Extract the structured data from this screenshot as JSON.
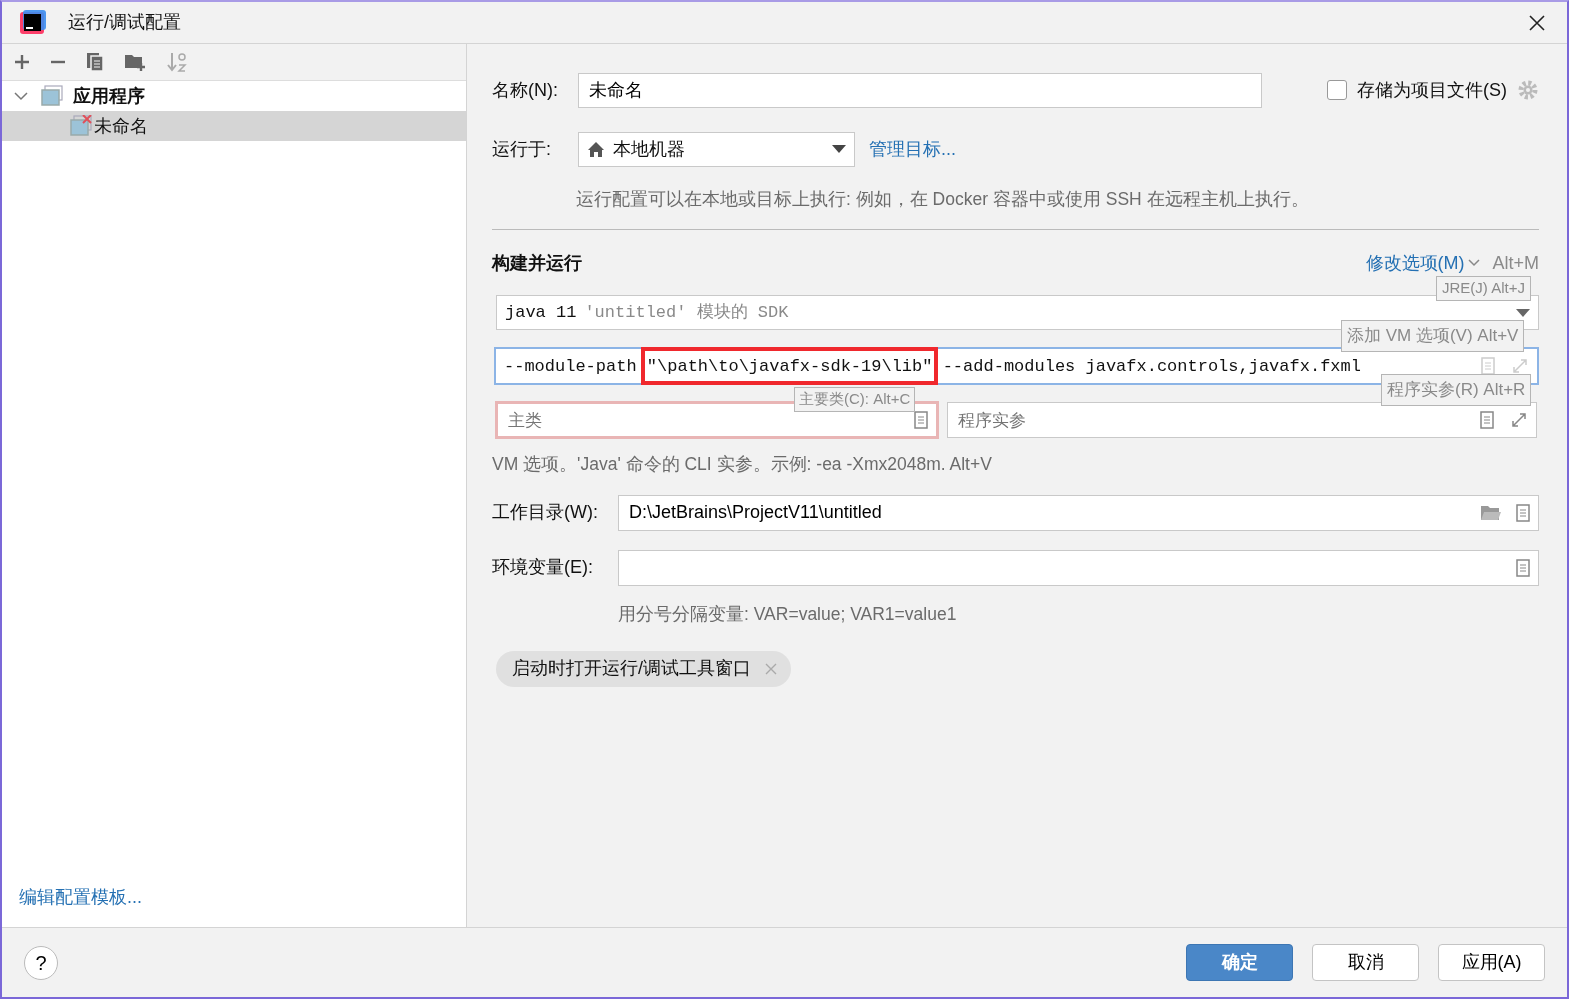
{
  "window": {
    "title": "运行/调试配置"
  },
  "tree": [
    {
      "label": "应用程序",
      "selected": false,
      "expanded": true,
      "children": [
        {
          "label": "未命名",
          "selected": true,
          "invalid": true
        }
      ]
    }
  ],
  "edit_templates_link": "编辑配置模板...",
  "name_field": {
    "label": "名称(N):",
    "value": "未命名"
  },
  "store_as_file": {
    "label": "存储为项目文件(S)",
    "checked": false
  },
  "run_on": {
    "label": "运行于:",
    "value": "本地机器",
    "manage_link": "管理目标...",
    "hint": "运行配置可以在本地或目标上执行: 例如，在 Docker 容器中或使用 SSH 在远程主机上执行。"
  },
  "build_run": {
    "heading": "构建并运行",
    "modify_link": "修改选项(M)",
    "modify_shortcut": "Alt+M",
    "jre": {
      "value": "java 11",
      "detail": "'untitled' 模块的 SDK"
    },
    "vm_options": {
      "value": "--module-path \"\\path\\to\\javafx-sdk-19\\lib\" --add-modules javafx.controls,javafx.fxml",
      "focused": true
    },
    "main_class": {
      "placeholder": "主类",
      "invalid": true
    },
    "program_args": {
      "placeholder": "程序实参"
    },
    "hint": "VM 选项。'Java' 命令的 CLI 实参。示例: -ea -Xmx2048m. Alt+V"
  },
  "tooltips": [
    {
      "kind": "jre",
      "text": "JRE(J) Alt+J"
    },
    {
      "kind": "vm",
      "text": "添加 VM 选项(V) Alt+V"
    },
    {
      "kind": "main",
      "text": "主要类(C): Alt+C"
    },
    {
      "kind": "args",
      "text": "程序实参(R) Alt+R"
    }
  ],
  "working_dir": {
    "label": "工作目录(W):",
    "value": "D:\\JetBrains\\ProjectV11\\untitled"
  },
  "env": {
    "label": "环境变量(E):",
    "hint": "用分号分隔变量: VAR=value; VAR1=value1"
  },
  "tag": {
    "label": "启动时打开运行/调试工具窗口"
  },
  "help": "?",
  "buttons": [
    {
      "label": "确定",
      "primary": true
    },
    {
      "label": "取消",
      "primary": false
    },
    {
      "label": "应用(A)",
      "primary": false
    }
  ]
}
